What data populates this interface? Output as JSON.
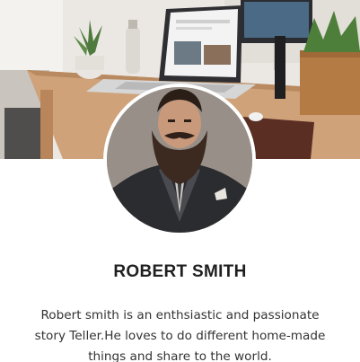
{
  "profile": {
    "name": "ROBERT SMITH",
    "bio": "Robert smith is an enthsiastic and passionate story Teller.He loves to do different home-made things and share to the world."
  },
  "colors": {
    "name_text": "#1f1f1f",
    "bio_text": "#333333",
    "avatar_border": "#ffffff",
    "background": "#ffffff"
  },
  "images": {
    "cover": "office-desk-photo",
    "avatar": "bearded-man-in-suit-photo"
  }
}
